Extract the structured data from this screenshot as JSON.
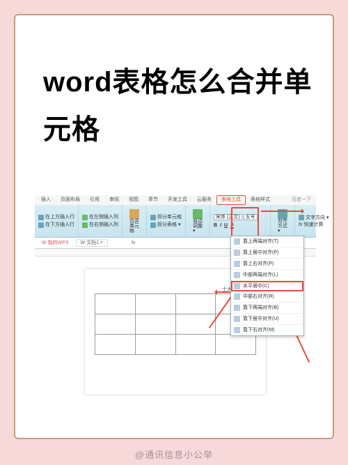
{
  "title": "word表格怎么合并单元格",
  "watermark": "@通讯信息小公举",
  "tabs": [
    "插入",
    "页面布局",
    "引用",
    "审阅",
    "视图",
    "章节",
    "开发工具",
    "云服务",
    "表格工具",
    "表格样式"
  ],
  "tab_active": "表格工具",
  "tab_right": "百度一下",
  "ribbon": {
    "group1": [
      {
        "label": "在上方插入行",
        "icon": "row-above"
      },
      {
        "label": "在下方插入行",
        "icon": "row-below"
      }
    ],
    "group2": [
      {
        "label": "在左侧插入列",
        "icon": "col-left"
      },
      {
        "label": "在右侧插入列",
        "icon": "col-right"
      }
    ],
    "group3": [
      {
        "big": "合并单元格",
        "icon": "merge"
      }
    ],
    "group4": [
      {
        "label": "拆分单元格",
        "icon": "split-cell"
      },
      {
        "label": "拆分表格 ▾",
        "icon": "split-table"
      }
    ],
    "group5": [
      {
        "big": "自动调整 ▾",
        "icon": "auto-fit"
      }
    ],
    "group6": {
      "font": "宋体 (正文)",
      "size": "五号",
      "bold": "B",
      "italic": "I",
      "under": "U",
      "color": "A"
    },
    "group7": {
      "big": "对齐方式 ▾",
      "icon": "align"
    },
    "group8": [
      {
        "big": "文字方向 ▾",
        "icon": "text-dir"
      },
      {
        "big": "fx",
        "label": "快速计算",
        "icon": "fx"
      }
    ]
  },
  "menu": [
    "靠上两端对齐(T)",
    "靠上居中对齐(P)",
    "靠上右对齐(P)",
    "中部两端对齐(L)",
    "水平居中(C)",
    "中部右对齐(R)",
    "靠下两端对齐(B)",
    "靠下居中对齐(U)",
    "靠下右对齐(M)"
  ],
  "menu_sel_index": 4,
  "doc_tabs": {
    "app": "我的WPS",
    "file": "文档1",
    "fx": "fx"
  },
  "cell_text": "士大夫撒士大夫",
  "table": {
    "rows": 3,
    "cols": 4
  }
}
